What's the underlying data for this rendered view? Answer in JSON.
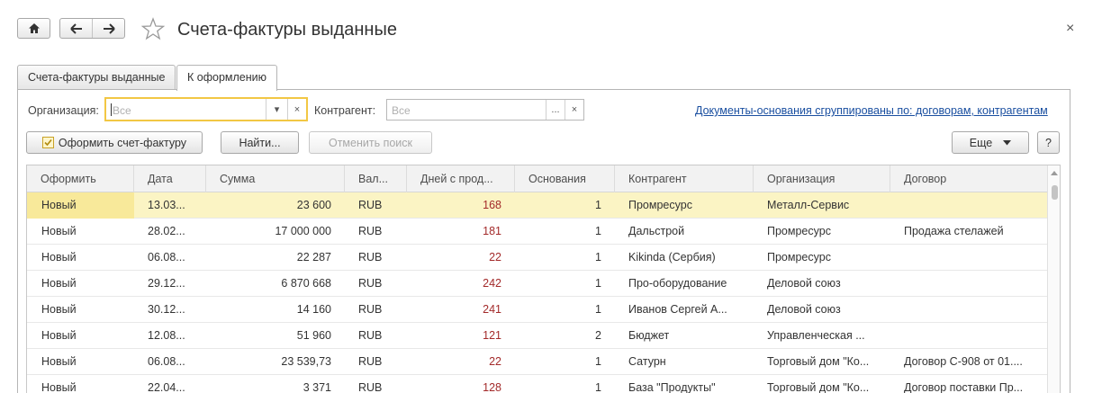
{
  "window": {
    "title": "Счета-фактуры выданные",
    "close_glyph": "×"
  },
  "icons": {
    "home": "home-icon",
    "back": "arrow-left-icon",
    "forward": "arrow-right-icon",
    "favorite": "star-icon",
    "close": "close-icon"
  },
  "tabs": [
    {
      "label": "Счета-фактуры выданные",
      "active": false
    },
    {
      "label": "К оформлению",
      "active": true
    }
  ],
  "filters": {
    "org_label": "Организация:",
    "org_placeholder": "Все",
    "contragent_label": "Контрагент:",
    "contragent_placeholder": "Все",
    "clear_glyph": "×",
    "dropdown_glyph": "▾",
    "select_glyph": "...",
    "grouping_link": "Документы-основания сгруппированы по: договорам, контрагентам"
  },
  "toolbar": {
    "create_invoice": "Оформить счет-фактуру",
    "find": "Найти...",
    "cancel_search": "Отменить поиск",
    "more": "Еще",
    "help": "?"
  },
  "table": {
    "columns": [
      "Оформить",
      "Дата",
      "Сумма",
      "Вал...",
      "Дней с прод...",
      "Основания",
      "Контрагент",
      "Организация",
      "Договор"
    ],
    "rows": [
      {
        "status": "Новый",
        "date": "13.03...",
        "sum": "23 600",
        "currency": "RUB",
        "days": "168",
        "bases": "1",
        "contragent": "Промресурс",
        "org": "Металл-Сервис",
        "contract": ""
      },
      {
        "status": "Новый",
        "date": "28.02...",
        "sum": "17 000 000",
        "currency": "RUB",
        "days": "181",
        "bases": "1",
        "contragent": "Дальстрой",
        "org": "Промресурс",
        "contract": "Продажа стелажей"
      },
      {
        "status": "Новый",
        "date": "06.08...",
        "sum": "22 287",
        "currency": "RUB",
        "days": "22",
        "bases": "1",
        "contragent": "Kikinda (Сербия)",
        "org": "Промресурс",
        "contract": ""
      },
      {
        "status": "Новый",
        "date": "29.12...",
        "sum": "6 870 668",
        "currency": "RUB",
        "days": "242",
        "bases": "1",
        "contragent": "Про-оборудование",
        "org": "Деловой союз",
        "contract": ""
      },
      {
        "status": "Новый",
        "date": "30.12...",
        "sum": "14 160",
        "currency": "RUB",
        "days": "241",
        "bases": "1",
        "contragent": "Иванов Сергей А...",
        "org": "Деловой союз",
        "contract": ""
      },
      {
        "status": "Новый",
        "date": "12.08...",
        "sum": "51 960",
        "currency": "RUB",
        "days": "121",
        "bases": "2",
        "contragent": "Бюджет",
        "org": "Управленческая ...",
        "contract": ""
      },
      {
        "status": "Новый",
        "date": "06.08...",
        "sum": "23 539,73",
        "currency": "RUB",
        "days": "22",
        "bases": "1",
        "contragent": "Сатурн",
        "org": "Торговый дом \"Ко...",
        "contract": "Договор С-908 от 01...."
      },
      {
        "status": "Новый",
        "date": "22.04...",
        "sum": "3 371",
        "currency": "RUB",
        "days": "128",
        "bases": "1",
        "contragent": "База \"Продукты\"",
        "org": "Торговый дом \"Ко...",
        "contract": "Договор поставки Пр..."
      }
    ]
  },
  "colors": {
    "accent_focus": "#f2c744",
    "selected_row": "#fbf4c4",
    "days_text": "#a32a2a",
    "link": "#1a4fa0"
  }
}
